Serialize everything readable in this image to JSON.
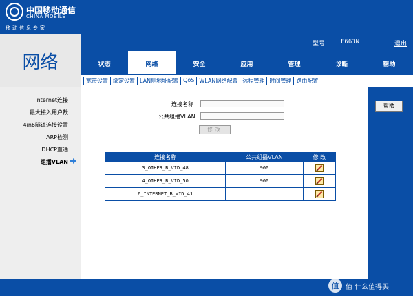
{
  "brand": {
    "name_cn": "中国移动通信",
    "name_en": "CHINA MOBILE",
    "slogan": "移动信息专家"
  },
  "header": {
    "section_title": "网络",
    "model_label": "型号:",
    "model_value": "F663N",
    "logout": "退出"
  },
  "tabs": [
    {
      "label": "状态"
    },
    {
      "label": "网络"
    },
    {
      "label": "安全"
    },
    {
      "label": "应用"
    },
    {
      "label": "管理"
    },
    {
      "label": "诊断"
    },
    {
      "label": "帮助"
    }
  ],
  "subnav": [
    {
      "label": "宽带设置"
    },
    {
      "label": "绑定设置"
    },
    {
      "label": "LAN侧地址配置"
    },
    {
      "label": "QoS"
    },
    {
      "label": "WLAN网络配置"
    },
    {
      "label": "远程管理"
    },
    {
      "label": "时间管理"
    },
    {
      "label": "路由配置"
    }
  ],
  "sidebar": [
    {
      "label": "Internet连接"
    },
    {
      "label": "最大接入用户数"
    },
    {
      "label": "4in6隧道连接设置"
    },
    {
      "label": "ARP检测"
    },
    {
      "label": "DHCP直通"
    },
    {
      "label": "组播VLAN"
    }
  ],
  "form": {
    "conn_name_label": "连接名称",
    "conn_name_value": "",
    "vlan_label": "公共组播VLAN",
    "vlan_value": "",
    "modify_button": "修改"
  },
  "table": {
    "headers": [
      "连接名称",
      "公共组播VLAN",
      "修 改"
    ],
    "rows": [
      {
        "name": "3_OTHER_B_VID_48",
        "vlan": "900",
        "has_edit": true
      },
      {
        "name": "4_OTHER_B_VID_50",
        "vlan": "900",
        "has_edit": true
      },
      {
        "name": "6_INTERNET_B_VID_41",
        "vlan": "",
        "has_edit": true
      }
    ]
  },
  "help": {
    "button": "帮助"
  },
  "watermark": {
    "text": "值 什么值得买"
  },
  "colors": {
    "primary": "#0a4ea6",
    "sidebar_bg": "#eeeeee"
  }
}
